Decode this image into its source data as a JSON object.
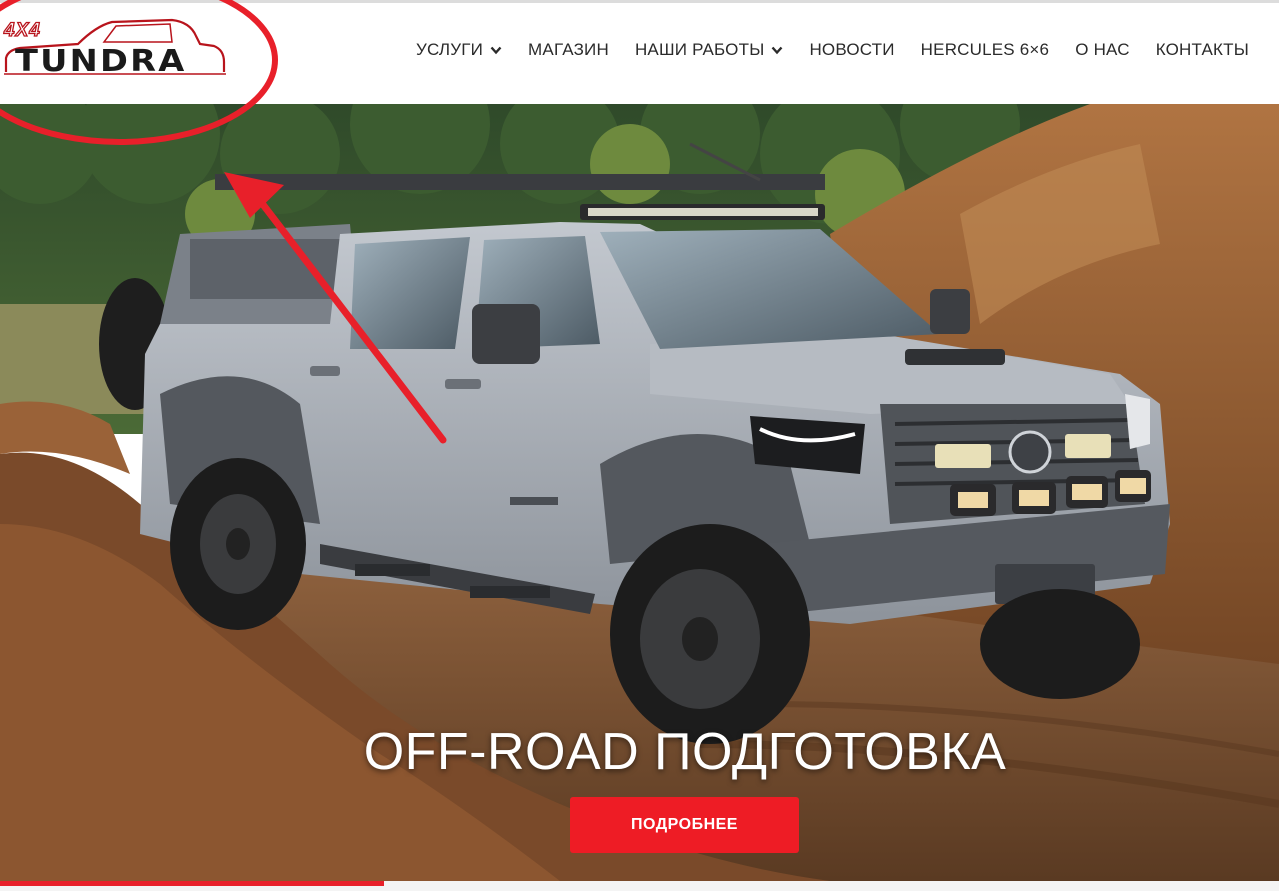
{
  "header": {
    "logo": {
      "badge": "4X4",
      "wordmark": "TUNDRA"
    },
    "nav": [
      {
        "label": "УСЛУГИ",
        "has_dropdown": true
      },
      {
        "label": "МАГАЗИН",
        "has_dropdown": false
      },
      {
        "label": "НАШИ РАБОТЫ",
        "has_dropdown": true
      },
      {
        "label": "НОВОСТИ",
        "has_dropdown": false
      },
      {
        "label": "HERCULES 6×6",
        "has_dropdown": false
      },
      {
        "label": "О НАС",
        "has_dropdown": false
      },
      {
        "label": "КОНТАКТЫ",
        "has_dropdown": false
      }
    ]
  },
  "hero": {
    "title": "OFF-ROAD ПОДГОТОВКА",
    "button_label": "ПОДРОБНЕЕ",
    "slider_progress": 0.3
  },
  "annotation": {
    "color": "#e8202a",
    "shapes": [
      "ellipse-around-logo",
      "arrow-to-logo"
    ]
  },
  "colors": {
    "accent": "#ee1c25",
    "nav_text": "#2b2b2b",
    "hero_text": "#ffffff"
  }
}
